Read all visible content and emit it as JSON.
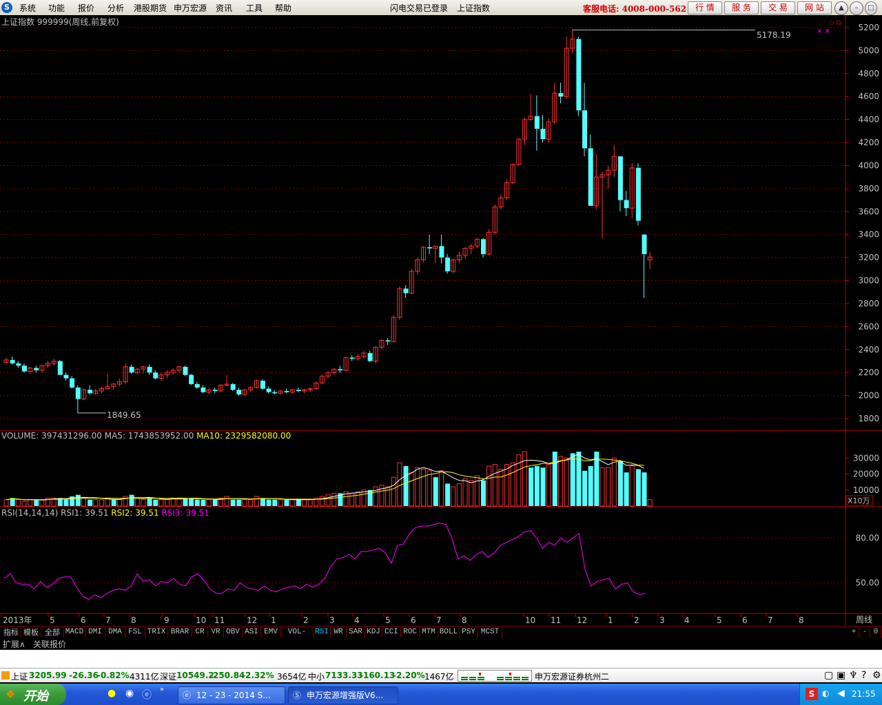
{
  "menu": {
    "logo": "S",
    "items": [
      "系统",
      "功能",
      "报价",
      "分析",
      "港股期货",
      "申万宏源",
      "资讯",
      "工具",
      "帮助"
    ],
    "status_login": "闪电交易已登录",
    "status_stock": "上证指数",
    "hotline": "客服电话: 4008-000-562",
    "buttons": [
      "行 情",
      "服 务",
      "交 易",
      "网 站"
    ],
    "window_buttons": [
      "▲",
      "–",
      "□",
      "✕"
    ]
  },
  "price_panel": {
    "title": "上证指数 999999(周线,前复权)",
    "high_label": "5178.19",
    "low_label": "1849.65",
    "y_ticks": [
      "5200",
      "5000",
      "4800",
      "4600",
      "4400",
      "4200",
      "4000",
      "3800",
      "3600",
      "3400",
      "3200",
      "3000",
      "2800",
      "2600",
      "2400",
      "2200",
      "2000",
      "1800"
    ],
    "ylim": [
      1800,
      5200
    ]
  },
  "volume_panel": {
    "name": "VOLUME:",
    "value": "397431296.00",
    "ma5_label": "MA5: 1743853952.00",
    "ma10_label": "MA10: 2329582080.00",
    "y_ticks": [
      "30000",
      "20000",
      "10000"
    ],
    "unit": "X10万"
  },
  "rsi_panel": {
    "name": "RSI(14,14,14)",
    "rsi1": "RSI1: 39.51",
    "rsi2": "RSI2: 39.51",
    "rsi3": "RSI3: 39.51",
    "y_ticks": [
      "80.00",
      "50.00"
    ]
  },
  "x_axis": {
    "labels": [
      "2013年",
      "5",
      "6",
      "7",
      "8",
      "9",
      "10",
      "11",
      "12",
      "1",
      "2",
      "3",
      "4",
      "5",
      "6",
      "7",
      "8",
      "10",
      "11",
      "12",
      "1",
      "2",
      "3",
      "4",
      "5",
      "6",
      "7",
      "8"
    ],
    "period": "周线"
  },
  "colors": {
    "up": "#ff3232",
    "down": "#54ffff",
    "grid": "#800000",
    "ma5": "#ffffff",
    "ma10": "#ffff00",
    "rsi": "#ff00ff"
  },
  "tabs": [
    "指标",
    "模板",
    "全部",
    "MACD",
    "DMI",
    "DMA",
    "FSL",
    "TRIX",
    "BRAR",
    "CR",
    "VR",
    "OBV",
    "ASI",
    "EMV",
    "VOL-TDX",
    "RSI",
    "WR",
    "SAR",
    "KDJ",
    "CCI",
    "ROC",
    "MTM",
    "BOLL",
    "PSY",
    "MCST"
  ],
  "tab_controls": [
    "+",
    "-",
    "0"
  ],
  "subtabs": [
    "扩展∧",
    "关联报价"
  ],
  "quote_bar": {
    "sh_name": "上证",
    "sh_price": "3205.99",
    "sh_change": "-26.36",
    "sh_pct": "-0.82%",
    "sh_amount": "4311亿",
    "sz_name": "深证",
    "sz_price": "10549.2",
    "sz_change": "-250.84",
    "sz_pct": "-2.32%",
    "sz_amount": "3654亿",
    "zx_name": "中小",
    "zx_price": "7133.33",
    "zx_change": "-160.13",
    "zx_pct": "-2.20%",
    "zx_amount": "1467亿",
    "broker": "申万宏源证券杭州二"
  },
  "taskbar": {
    "start": "开始",
    "tasks": [
      "12 - 23 - 2014 S...",
      "申万宏源增强版V6..."
    ],
    "time": "21:55"
  },
  "chart_data": {
    "type": "candlestick",
    "ylim": [
      1800,
      5200
    ],
    "candles_ohlc": [
      [
        2290,
        2330,
        2270,
        2310
      ],
      [
        2310,
        2340,
        2270,
        2280
      ],
      [
        2280,
        2300,
        2240,
        2260
      ],
      [
        2260,
        2280,
        2200,
        2210
      ],
      [
        2210,
        2250,
        2190,
        2240
      ],
      [
        2240,
        2260,
        2200,
        2220
      ],
      [
        2220,
        2270,
        2200,
        2260
      ],
      [
        2260,
        2300,
        2240,
        2280
      ],
      [
        2280,
        2320,
        2260,
        2300
      ],
      [
        2300,
        2310,
        2240,
        2180
      ],
      [
        2180,
        2200,
        2130,
        2150
      ],
      [
        2150,
        2170,
        2060,
        2070
      ],
      [
        2070,
        2090,
        1849,
        1970
      ],
      [
        1970,
        2060,
        1960,
        2050
      ],
      [
        2050,
        2090,
        2010,
        2020
      ],
      [
        2020,
        2060,
        2000,
        2040
      ],
      [
        2040,
        2080,
        2020,
        2060
      ],
      [
        2060,
        2190,
        2050,
        2080
      ],
      [
        2080,
        2110,
        2050,
        2100
      ],
      [
        2100,
        2150,
        2080,
        2120
      ],
      [
        2120,
        2280,
        2100,
        2250
      ],
      [
        2250,
        2270,
        2190,
        2200
      ],
      [
        2200,
        2240,
        2180,
        2230
      ],
      [
        2230,
        2260,
        2190,
        2250
      ],
      [
        2250,
        2270,
        2180,
        2200
      ],
      [
        2200,
        2220,
        2140,
        2150
      ],
      [
        2150,
        2200,
        2130,
        2180
      ],
      [
        2180,
        2220,
        2150,
        2200
      ],
      [
        2200,
        2240,
        2180,
        2220
      ],
      [
        2220,
        2260,
        2200,
        2250
      ],
      [
        2250,
        2260,
        2170,
        2180
      ],
      [
        2180,
        2190,
        2090,
        2100
      ],
      [
        2100,
        2120,
        2060,
        2070
      ],
      [
        2070,
        2090,
        2020,
        2030
      ],
      [
        2030,
        2060,
        2010,
        2050
      ],
      [
        2050,
        2070,
        2020,
        2040
      ],
      [
        2040,
        2100,
        2030,
        2090
      ],
      [
        2090,
        2180,
        2080,
        2100
      ],
      [
        2100,
        2110,
        2040,
        2050
      ],
      [
        2050,
        2070,
        2000,
        2010
      ],
      [
        2010,
        2060,
        2000,
        2050
      ],
      [
        2050,
        2080,
        2030,
        2070
      ],
      [
        2070,
        2140,
        2060,
        2130
      ],
      [
        2130,
        2140,
        2050,
        2060
      ],
      [
        2060,
        2080,
        2020,
        2030
      ],
      [
        2030,
        2050,
        2010,
        2020
      ],
      [
        2020,
        2050,
        2010,
        2040
      ],
      [
        2040,
        2060,
        2020,
        2030
      ],
      [
        2030,
        2060,
        2020,
        2050
      ],
      [
        2050,
        2070,
        2030,
        2040
      ],
      [
        2040,
        2060,
        2020,
        2050
      ],
      [
        2050,
        2070,
        2030,
        2060
      ],
      [
        2060,
        2120,
        2050,
        2110
      ],
      [
        2110,
        2180,
        2100,
        2170
      ],
      [
        2170,
        2210,
        2150,
        2200
      ],
      [
        2200,
        2240,
        2180,
        2230
      ],
      [
        2230,
        2260,
        2200,
        2220
      ],
      [
        2220,
        2340,
        2210,
        2330
      ],
      [
        2330,
        2350,
        2300,
        2320
      ],
      [
        2320,
        2360,
        2300,
        2340
      ],
      [
        2340,
        2390,
        2320,
        2370
      ],
      [
        2370,
        2390,
        2290,
        2300
      ],
      [
        2300,
        2430,
        2280,
        2420
      ],
      [
        2420,
        2490,
        2400,
        2480
      ],
      [
        2480,
        2500,
        2440,
        2470
      ],
      [
        2470,
        2700,
        2460,
        2680
      ],
      [
        2680,
        2950,
        2660,
        2930
      ],
      [
        2930,
        2960,
        2850,
        2890
      ],
      [
        2890,
        3100,
        2880,
        3080
      ],
      [
        3080,
        3200,
        3050,
        3180
      ],
      [
        3180,
        3300,
        3160,
        3290
      ],
      [
        3290,
        3400,
        3230,
        3280
      ],
      [
        3280,
        3300,
        3150,
        3300
      ],
      [
        3300,
        3400,
        3150,
        3200
      ],
      [
        3200,
        3230,
        3060,
        3080
      ],
      [
        3080,
        3190,
        3060,
        3180
      ],
      [
        3180,
        3250,
        3150,
        3220
      ],
      [
        3220,
        3290,
        3190,
        3280
      ],
      [
        3280,
        3320,
        3230,
        3300
      ],
      [
        3300,
        3370,
        3280,
        3360
      ],
      [
        3360,
        3370,
        3200,
        3230
      ],
      [
        3230,
        3450,
        3220,
        3420
      ],
      [
        3420,
        3660,
        3400,
        3640
      ],
      [
        3640,
        3750,
        3620,
        3720
      ],
      [
        3720,
        3880,
        3700,
        3850
      ],
      [
        3850,
        4020,
        3840,
        4010
      ],
      [
        4010,
        4240,
        4000,
        4230
      ],
      [
        4230,
        4420,
        4180,
        4400
      ],
      [
        4400,
        4620,
        4390,
        4430
      ],
      [
        4430,
        4610,
        4130,
        4320
      ],
      [
        4320,
        4440,
        4200,
        4230
      ],
      [
        4230,
        4410,
        4200,
        4380
      ],
      [
        4380,
        4720,
        4360,
        4630
      ],
      [
        4630,
        4720,
        4540,
        4600
      ],
      [
        4600,
        5120,
        4580,
        5020
      ],
      [
        5020,
        5178,
        4980,
        5100
      ],
      [
        5100,
        5120,
        4430,
        4480
      ],
      [
        4480,
        4720,
        4080,
        4150
      ],
      [
        4150,
        4270,
        3760,
        3650
      ],
      [
        3650,
        4100,
        3620,
        3900
      ],
      [
        3900,
        3950,
        3370,
        3920
      ],
      [
        3920,
        4000,
        3800,
        3960
      ],
      [
        3960,
        4180,
        3900,
        4080
      ],
      [
        4080,
        4000,
        3600,
        3700
      ],
      [
        3700,
        3780,
        3560,
        3630
      ],
      [
        3630,
        4020,
        3540,
        3980
      ],
      [
        3980,
        4020,
        3480,
        3520
      ],
      [
        3400,
        3400,
        2850,
        3230
      ],
      [
        3180,
        3250,
        3100,
        3205
      ]
    ],
    "volume": [
      [
        4,
        1
      ],
      [
        5,
        0
      ],
      [
        4,
        1
      ],
      [
        3,
        1
      ],
      [
        4,
        1
      ],
      [
        4,
        0
      ],
      [
        4,
        1
      ],
      [
        5,
        1
      ],
      [
        5,
        1
      ],
      [
        5,
        0
      ],
      [
        4,
        0
      ],
      [
        6,
        0
      ],
      [
        7,
        0
      ],
      [
        5,
        1
      ],
      [
        4,
        0
      ],
      [
        4,
        1
      ],
      [
        4,
        1
      ],
      [
        5,
        1
      ],
      [
        4,
        0
      ],
      [
        4,
        1
      ],
      [
        6,
        1
      ],
      [
        7,
        0
      ],
      [
        5,
        1
      ],
      [
        4,
        1
      ],
      [
        5,
        0
      ],
      [
        4,
        0
      ],
      [
        4,
        1
      ],
      [
        4,
        1
      ],
      [
        5,
        1
      ],
      [
        5,
        1
      ],
      [
        5,
        0
      ],
      [
        5,
        0
      ],
      [
        4,
        0
      ],
      [
        4,
        0
      ],
      [
        4,
        1
      ],
      [
        4,
        0
      ],
      [
        5,
        1
      ],
      [
        6,
        1
      ],
      [
        4,
        0
      ],
      [
        4,
        0
      ],
      [
        4,
        1
      ],
      [
        4,
        1
      ],
      [
        6,
        1
      ],
      [
        5,
        0
      ],
      [
        4,
        0
      ],
      [
        4,
        0
      ],
      [
        4,
        1
      ],
      [
        4,
        0
      ],
      [
        4,
        1
      ],
      [
        4,
        0
      ],
      [
        4,
        1
      ],
      [
        4,
        1
      ],
      [
        5,
        1
      ],
      [
        6,
        1
      ],
      [
        7,
        1
      ],
      [
        8,
        1
      ],
      [
        8,
        0
      ],
      [
        9,
        1
      ],
      [
        8,
        1
      ],
      [
        9,
        1
      ],
      [
        10,
        1
      ],
      [
        10,
        0
      ],
      [
        12,
        1
      ],
      [
        13,
        1
      ],
      [
        12,
        1
      ],
      [
        18,
        1
      ],
      [
        27,
        1
      ],
      [
        25,
        0
      ],
      [
        21,
        1
      ],
      [
        24,
        1
      ],
      [
        23,
        1
      ],
      [
        22,
        1
      ],
      [
        18,
        0
      ],
      [
        22,
        1
      ],
      [
        14,
        0
      ],
      [
        12,
        1
      ],
      [
        14,
        1
      ],
      [
        17,
        1
      ],
      [
        16,
        1
      ],
      [
        19,
        1
      ],
      [
        16,
        0
      ],
      [
        25,
        1
      ],
      [
        26,
        1
      ],
      [
        23,
        1
      ],
      [
        26,
        1
      ],
      [
        27,
        1
      ],
      [
        32,
        1
      ],
      [
        34,
        1
      ],
      [
        24,
        0
      ],
      [
        25,
        0
      ],
      [
        24,
        0
      ],
      [
        26,
        1
      ],
      [
        34,
        0
      ],
      [
        31,
        1
      ],
      [
        30,
        1
      ],
      [
        33,
        0
      ],
      [
        34,
        0
      ],
      [
        22,
        0
      ],
      [
        25,
        0
      ],
      [
        34,
        0
      ],
      [
        24,
        1
      ],
      [
        24,
        1
      ],
      [
        30,
        1
      ],
      [
        28,
        0
      ],
      [
        21,
        0
      ],
      [
        25,
        1
      ],
      [
        23,
        0
      ],
      [
        21,
        0
      ],
      [
        4,
        1
      ]
    ],
    "rsi": [
      53,
      56,
      50,
      49,
      49,
      46,
      51,
      47,
      49,
      53,
      54,
      54,
      47,
      41,
      39,
      42,
      40,
      43,
      45,
      46,
      45,
      48,
      56,
      51,
      52,
      48,
      51,
      50,
      53,
      49,
      48,
      54,
      56,
      52,
      46,
      43,
      43,
      46,
      45,
      50,
      47,
      46,
      45,
      48,
      45,
      44,
      46,
      47,
      48,
      46,
      49,
      47,
      49,
      53,
      61,
      66,
      67,
      69,
      66,
      71,
      71,
      72,
      73,
      70,
      63,
      75,
      76,
      83,
      87,
      88,
      88,
      89,
      90,
      89,
      80,
      66,
      68,
      65,
      69,
      71,
      67,
      70,
      75,
      77,
      79,
      81,
      84,
      85,
      80,
      73,
      77,
      75,
      80,
      77,
      80,
      83,
      59,
      48,
      51,
      52,
      53,
      46,
      49,
      50,
      44,
      42,
      43
    ]
  }
}
